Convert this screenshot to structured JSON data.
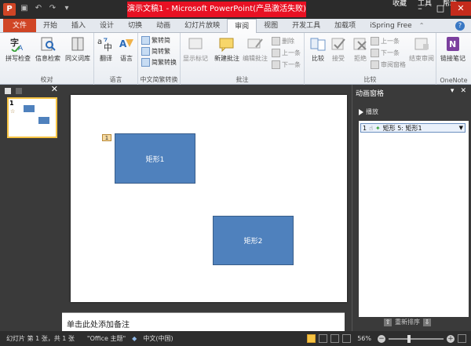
{
  "window": {
    "title": "演示文稿1 - Microsoft PowerPoint(产品激活失败)",
    "help_menu": [
      "文件",
      "收藏",
      "工具",
      "帮助"
    ]
  },
  "tabs": [
    {
      "label": "文件",
      "id": "file"
    },
    {
      "label": "开始",
      "id": "home"
    },
    {
      "label": "插入",
      "id": "insert"
    },
    {
      "label": "设计",
      "id": "design"
    },
    {
      "label": "切换",
      "id": "transitions"
    },
    {
      "label": "动画",
      "id": "animations"
    },
    {
      "label": "幻灯片放映",
      "id": "slideshow"
    },
    {
      "label": "审阅",
      "id": "review",
      "active": true
    },
    {
      "label": "视图",
      "id": "view"
    },
    {
      "label": "开发工具",
      "id": "developer"
    },
    {
      "label": "加载项",
      "id": "addins"
    },
    {
      "label": "iSpring Free",
      "id": "ispring"
    }
  ],
  "ribbon": {
    "proofing": {
      "label": "校对",
      "spelling": "拼写检查",
      "research": "信息检索",
      "thesaurus": "同义词库"
    },
    "language": {
      "label": "语言",
      "translate": "翻译",
      "language": "语言"
    },
    "chinese": {
      "label": "中文简繁转换",
      "to_simplified": "繁转简",
      "to_traditional": "简转繁",
      "convert": "简繁转换"
    },
    "comments": {
      "label": "批注",
      "show_markup": "显示标记",
      "new_comment": "新建批注",
      "edit_comment": "编辑批注",
      "delete": "删除",
      "previous": "上一条",
      "next": "下一条"
    },
    "compare": {
      "label": "比较",
      "compare": "比较",
      "accept": "接受",
      "reject": "拒绝",
      "previous": "上一条",
      "next": "下一条",
      "reviewing_pane": "审阅窗格",
      "end_review": "结束审阅"
    },
    "onenote": {
      "label": "OneNote",
      "linked_notes": "链接笔记"
    }
  },
  "slide_panel": {
    "thumb_number": "1"
  },
  "slide": {
    "shapes": [
      {
        "label": "矩形1",
        "tag": "1"
      },
      {
        "label": "矩形2"
      }
    ]
  },
  "notes": {
    "placeholder": "单击此处添加备注"
  },
  "animation_pane": {
    "title": "动画窗格",
    "play_label": "播放",
    "items": [
      {
        "index": "1",
        "label": "矩形 5: 矩形1"
      }
    ],
    "reorder_label": "重新排序"
  },
  "status": {
    "slide_info": "幻灯片 第 1 张，共 1 张",
    "theme": "\"Office 主题\"",
    "language": "中文(中国)",
    "zoom": "56%"
  },
  "colors": {
    "accent": "#d04525",
    "shape_fill": "#4f81bd",
    "title_alert": "#e81123"
  }
}
